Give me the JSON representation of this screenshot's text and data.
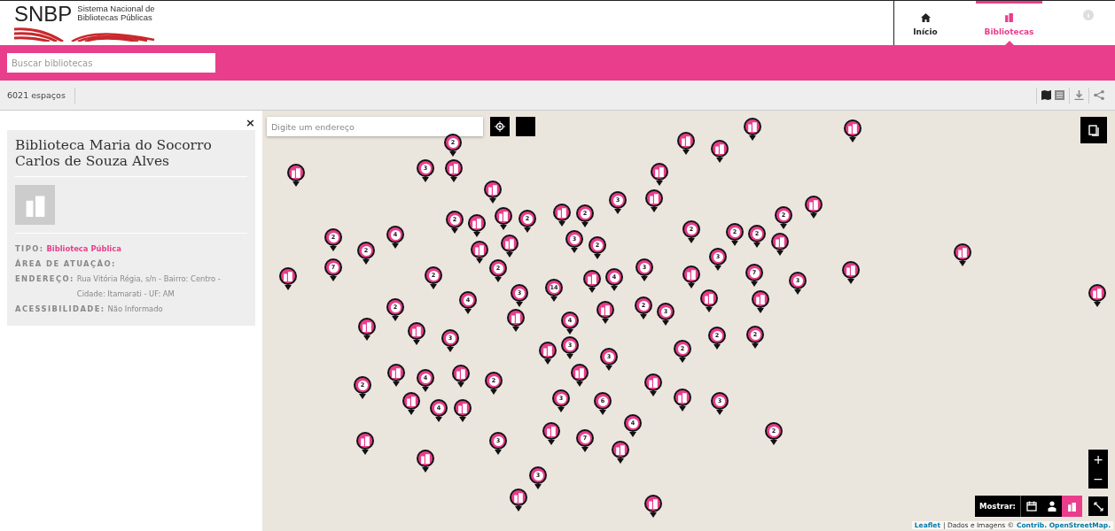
{
  "logo": {
    "wordmark": "SNBP",
    "subtitle_line_1": "Sistema Nacional de",
    "subtitle_line_2": "Bibliotecas  Públicas"
  },
  "nav": [
    {
      "label": "Início",
      "selected": false
    },
    {
      "label": "Bibliotecas",
      "selected": true
    }
  ],
  "search": {
    "placeholder": "Buscar bibliotecas"
  },
  "toolbar": {
    "count": "6021 espaços"
  },
  "detail": {
    "close": "×",
    "title": "Biblioteca Maria do Socorro Carlos de Souza Alves",
    "fields": [
      {
        "label": "TIPO:",
        "value": "Biblioteca Pública",
        "kind": "link"
      },
      {
        "label": "ÁREA DE ATUAÇÃO:",
        "kind": "text"
      },
      {
        "label": "ENDEREÇO:",
        "value": "Rua Vitória Régia, s/n - Bairro: Centro - Cidade: Itamarati - UF: AM",
        "kind": "text"
      },
      {
        "label": "ACESSIBILIDADE:",
        "value": "Não Informado",
        "kind": "text"
      }
    ]
  },
  "map": {
    "address_placeholder": "Digite um endereço",
    "zoom_in": "+",
    "zoom_out": "−",
    "show_label": "Mostrar:",
    "filters": [
      {
        "selected": false
      },
      {
        "selected": false
      },
      {
        "selected": true
      }
    ],
    "attribution_link": "Leaflet",
    "attribution_text": "| Dados e Imagens ©",
    "attribution_source": "Contrib. OpenStreetMap.",
    "markers": [
      {
        "kind": "cluster",
        "count": "2"
      },
      {
        "kind": "cluster",
        "count": "3"
      },
      {
        "kind": "cluster",
        "count": "2"
      },
      {
        "kind": "cluster",
        "count": "2"
      },
      {
        "kind": "cluster",
        "count": "2"
      },
      {
        "kind": "cluster",
        "count": "3"
      },
      {
        "kind": "cluster",
        "count": "2"
      },
      {
        "kind": "cluster",
        "count": "3"
      },
      {
        "kind": "cluster",
        "count": "4"
      },
      {
        "kind": "cluster",
        "count": "2"
      },
      {
        "kind": "cluster",
        "count": "2"
      },
      {
        "kind": "cluster",
        "count": "7"
      },
      {
        "kind": "cluster",
        "count": "2"
      },
      {
        "kind": "cluster",
        "count": "2"
      },
      {
        "kind": "cluster",
        "count": "3"
      },
      {
        "kind": "cluster",
        "count": "4"
      },
      {
        "kind": "cluster",
        "count": "14"
      },
      {
        "kind": "cluster",
        "count": "4"
      },
      {
        "kind": "cluster",
        "count": "3"
      },
      {
        "kind": "cluster",
        "count": "2"
      },
      {
        "kind": "cluster",
        "count": "2"
      },
      {
        "kind": "cluster",
        "count": "2"
      },
      {
        "kind": "cluster",
        "count": "2"
      },
      {
        "kind": "cluster",
        "count": "3"
      },
      {
        "kind": "cluster",
        "count": "7"
      },
      {
        "kind": "cluster",
        "count": "3"
      },
      {
        "kind": "cluster",
        "count": "2"
      },
      {
        "kind": "cluster",
        "count": "3"
      },
      {
        "kind": "cluster",
        "count": "4"
      },
      {
        "kind": "cluster",
        "count": "3"
      },
      {
        "kind": "cluster",
        "count": "2"
      },
      {
        "kind": "cluster",
        "count": "3"
      },
      {
        "kind": "cluster",
        "count": "3"
      },
      {
        "kind": "cluster",
        "count": "2"
      },
      {
        "kind": "cluster",
        "count": "2"
      },
      {
        "kind": "cluster",
        "count": "2"
      },
      {
        "kind": "cluster",
        "count": "4"
      },
      {
        "kind": "cluster",
        "count": "2"
      },
      {
        "kind": "cluster",
        "count": "2"
      },
      {
        "kind": "cluster",
        "count": "3"
      },
      {
        "kind": "cluster",
        "count": "6"
      },
      {
        "kind": "cluster",
        "count": "4"
      },
      {
        "kind": "cluster",
        "count": "3"
      },
      {
        "kind": "cluster",
        "count": "4"
      },
      {
        "kind": "cluster",
        "count": "7"
      },
      {
        "kind": "cluster",
        "count": "3"
      },
      {
        "kind": "cluster",
        "count": "2"
      },
      {
        "kind": "cluster",
        "count": "3"
      },
      {
        "kind": "library"
      },
      {
        "kind": "library"
      },
      {
        "kind": "library"
      },
      {
        "kind": "library"
      },
      {
        "kind": "library"
      },
      {
        "kind": "library"
      },
      {
        "kind": "library"
      },
      {
        "kind": "library"
      },
      {
        "kind": "library"
      },
      {
        "kind": "library"
      },
      {
        "kind": "library"
      },
      {
        "kind": "library"
      },
      {
        "kind": "library"
      },
      {
        "kind": "library"
      },
      {
        "kind": "library"
      },
      {
        "kind": "library"
      },
      {
        "kind": "library"
      },
      {
        "kind": "library"
      },
      {
        "kind": "library"
      },
      {
        "kind": "library"
      },
      {
        "kind": "library"
      },
      {
        "kind": "library"
      },
      {
        "kind": "library"
      },
      {
        "kind": "library"
      },
      {
        "kind": "library"
      },
      {
        "kind": "library"
      },
      {
        "kind": "library"
      },
      {
        "kind": "library"
      },
      {
        "kind": "library"
      },
      {
        "kind": "library"
      },
      {
        "kind": "library"
      },
      {
        "kind": "library"
      },
      {
        "kind": "library"
      },
      {
        "kind": "library"
      },
      {
        "kind": "library"
      },
      {
        "kind": "library"
      },
      {
        "kind": "library"
      },
      {
        "kind": "library"
      },
      {
        "kind": "library"
      },
      {
        "kind": "library"
      },
      {
        "kind": "library"
      },
      {
        "kind": "library"
      }
    ]
  }
}
